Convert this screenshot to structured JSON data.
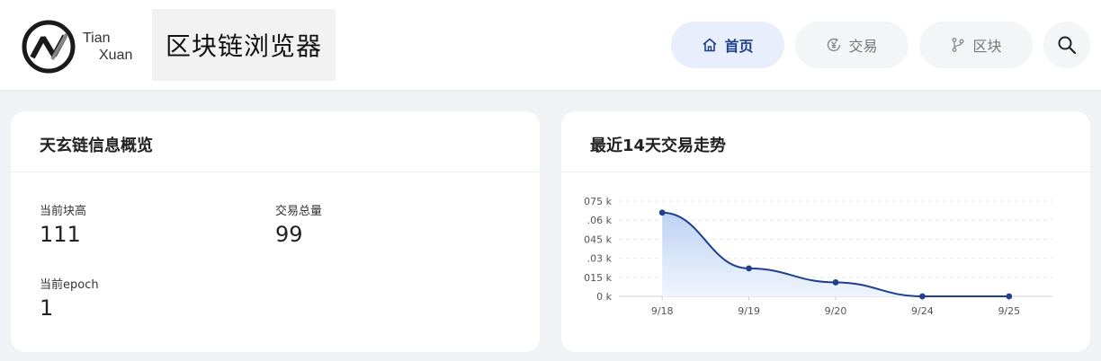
{
  "header": {
    "logo_line1": "Tian",
    "logo_line2": "Xuan",
    "site_title": "区块链浏览器"
  },
  "nav": {
    "home": "首页",
    "transactions": "交易",
    "blocks": "区块"
  },
  "overview": {
    "title": "天玄链信息概览",
    "stats": [
      {
        "label": "当前块高",
        "value": "111"
      },
      {
        "label": "交易总量",
        "value": "99"
      },
      {
        "label": "当前epoch",
        "value": "1"
      }
    ]
  },
  "trend": {
    "title": "最近14天交易走势"
  },
  "chart_data": {
    "type": "area",
    "categories": [
      "9/18",
      "9/19",
      "9/20",
      "9/24",
      "9/25"
    ],
    "values": [
      0.066,
      0.022,
      0.011,
      0,
      0
    ],
    "ytick_labels": [
      "0 k",
      "015 k",
      ".03 k",
      "045 k",
      ".06 k",
      "075 k"
    ],
    "ylim": [
      0,
      0.075
    ],
    "grid": true,
    "smooth": true,
    "colors": {
      "line": "#1f3f8f",
      "fill_top": "#b9cff2",
      "fill_bottom": "#eef4fd"
    }
  }
}
